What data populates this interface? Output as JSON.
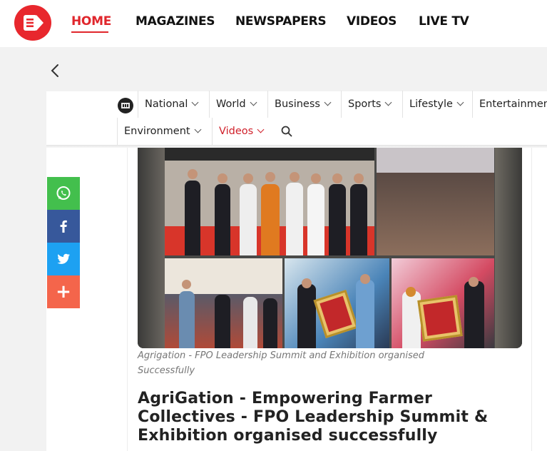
{
  "header": {
    "logo_icon": "play-logo-icon",
    "nav": [
      {
        "label": "HOME",
        "active": true
      },
      {
        "label": "MAGAZINES",
        "active": false
      },
      {
        "label": "NEWSPAPERS",
        "active": false
      },
      {
        "label": "VIDEOS",
        "active": false
      },
      {
        "label": "LIVE TV",
        "active": false
      }
    ]
  },
  "back_icon": "chevron-left-icon",
  "subnav": {
    "emblem_icon": "emblem-icon",
    "items": [
      {
        "label": "National",
        "has_dropdown": true
      },
      {
        "label": "World",
        "has_dropdown": true
      },
      {
        "label": "Business",
        "has_dropdown": true
      },
      {
        "label": "Sports",
        "has_dropdown": true
      },
      {
        "label": "Lifestyle",
        "has_dropdown": true
      },
      {
        "label": "Entertainmen",
        "has_dropdown": false
      },
      {
        "label": "Environment",
        "has_dropdown": true
      },
      {
        "label": "Videos",
        "has_dropdown": true,
        "active": true
      }
    ],
    "search_icon": "search-icon"
  },
  "share": [
    {
      "name": "whatsapp-icon",
      "color": "#43bf4d"
    },
    {
      "name": "facebook-icon",
      "color": "#37589b"
    },
    {
      "name": "twitter-icon",
      "color": "#1da1f2"
    },
    {
      "name": "plus-icon",
      "color": "#f4654b",
      "glyph": "+"
    }
  ],
  "article": {
    "caption": "Agrigation - FPO Leadership Summit and Exhibition organised Successfully",
    "headline": "AgriGation - Empowering Farmer Collectives - FPO Leadership Summit & Exhibition organised successfully"
  },
  "colors": {
    "accent": "#e0262c",
    "logo": "#e8272d"
  }
}
